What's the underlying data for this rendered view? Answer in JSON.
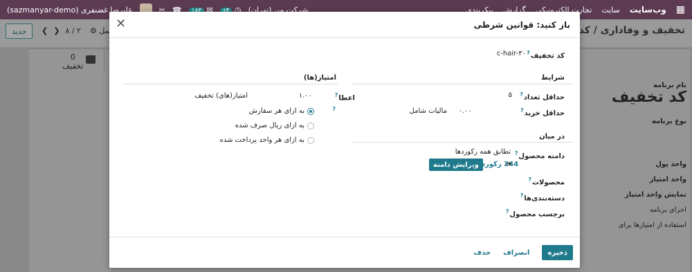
{
  "topnav": {
    "brand": "وب‌سایت",
    "menus": [
      "سایت",
      "تجارت الکترونیکی",
      "گزارش",
      "پیکربندی"
    ],
    "company": "شرکت من (تهران)",
    "badge_chat": "۱۸۳",
    "badge_activity": "۶۴",
    "user": "علیرضا غضنفری (sazmanyar-demo)"
  },
  "control_panel": {
    "new_button": "جدید",
    "pager": "۸ / ۲",
    "action": "عمل",
    "breadcrumb": "تخفیف و وفاداری / کد تخفیف"
  },
  "stat_button": {
    "count": "0",
    "label": "تخفیف"
  },
  "background_form": {
    "program_name_label": "نام برنامه",
    "program_name_value": "کد تخفیف",
    "program_type_label": "نوع برنامه",
    "currency_label": "واحد پول",
    "points_unit_label": "واحد امتیاز",
    "show_points_label": "نمایش واحد امتیاز",
    "apply_program_label": "اجرای برنامه",
    "use_points_label": "استفاده از امتیازها برای"
  },
  "modal": {
    "title": "باز کنید: قوانین شرطی",
    "discount_code_label": "کد تخفیف",
    "discount_code_value": "c-hair-۳۰",
    "conditions": {
      "title": "شرایط",
      "min_qty_label": "حداقل تعداد",
      "min_qty_value": "۵",
      "min_purchase_label": "حداقل خرید",
      "min_purchase_value": "۰.۰۰",
      "min_purchase_tax": "مالیات شامل"
    },
    "among": {
      "title": "در میان",
      "domain_label": "دامنه محصول",
      "domain_value": "تطابق همه رکوردها",
      "records_link": "244 رکورد",
      "edit_domain_button": "ویرایش دامنه",
      "products_label": "محصولات",
      "categories_label": "دسته‌بندی‌ها",
      "tag_label": "برچسب محصول"
    },
    "points": {
      "title": "امتیاز(ها)",
      "grant_label": "اعطا",
      "grant_value": "۱.۰۰",
      "grant_unit": "امتیاز(های) تخفیف",
      "options": [
        "به ازای هر سفارش",
        "به ازای ریال صرف شده",
        "به ازای هر واحد پرداخت شده"
      ],
      "selected": 0
    },
    "footer": {
      "save": "ذخیره",
      "discard": "انصراف",
      "delete": "حذف"
    }
  }
}
